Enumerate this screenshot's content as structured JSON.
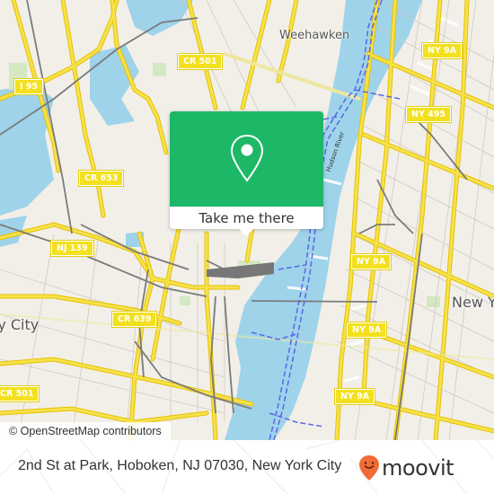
{
  "map": {
    "road_shields": [
      {
        "label": "I 95"
      },
      {
        "label": "CR 501"
      },
      {
        "label": "CR 653"
      },
      {
        "label": "NJ 139"
      },
      {
        "label": "CR 639"
      },
      {
        "label": "CR 501"
      },
      {
        "label": "NY 9A"
      },
      {
        "label": "NY 495"
      },
      {
        "label": "NY 9A"
      },
      {
        "label": "NY 9A"
      },
      {
        "label": "NY 9A"
      }
    ],
    "places": {
      "weehawken": "Weehawken",
      "jersey_city": "Jersey City",
      "new_york": "New York"
    },
    "river_label": "Hudson River",
    "attribution": "© OpenStreetMap contributors",
    "colors": {
      "land": "#f2efe9",
      "water": "#9fd3ea",
      "major_road": "#f7e14b",
      "minor_road": "#cfcac2",
      "rail": "#7b7b7b",
      "ferry": "#5a66e6",
      "park": "#d4e8c1"
    }
  },
  "popup": {
    "icon": "map-pin-icon",
    "button_label": "Take me there",
    "color": "#1db768"
  },
  "footer": {
    "address": "2nd St at Park, Hoboken, NJ 07030, New York City",
    "logo_text": "moovit",
    "logo_icon": "moovit-pin-smile-icon",
    "logo_color": "#f26a35"
  }
}
